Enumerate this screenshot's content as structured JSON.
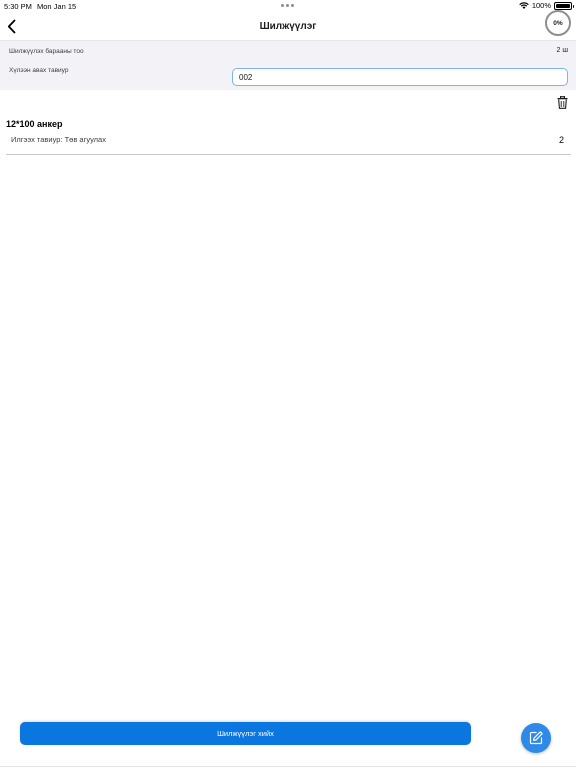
{
  "status_bar": {
    "time": "5:30 PM",
    "date": "Mon Jan 15",
    "battery": "100%"
  },
  "nav": {
    "title": "Шилжүүлэг",
    "progress_label": "0%",
    "back_icon": "chevron-left-icon"
  },
  "summary": {
    "quantity_label": "Шилжүүлэх барааны тоо",
    "quantity_value": "2 ш",
    "shelf_label": "Хүлээн авах тавиур",
    "shelf_value": "002"
  },
  "items": [
    {
      "name": "12*100 анкер",
      "sender": "Илгээх тавиур: Төв агуулах",
      "quantity": "2"
    }
  ],
  "actions": {
    "transfer_label": "Шилжүүлэг хийх",
    "delete_icon": "trash-icon",
    "edit_icon": "edit-pencil-icon"
  },
  "colors": {
    "primary": "#0a76e0",
    "fab": "#2e8ae6",
    "panel": "#f2f2f7",
    "input_border": "#7fb3e6"
  }
}
